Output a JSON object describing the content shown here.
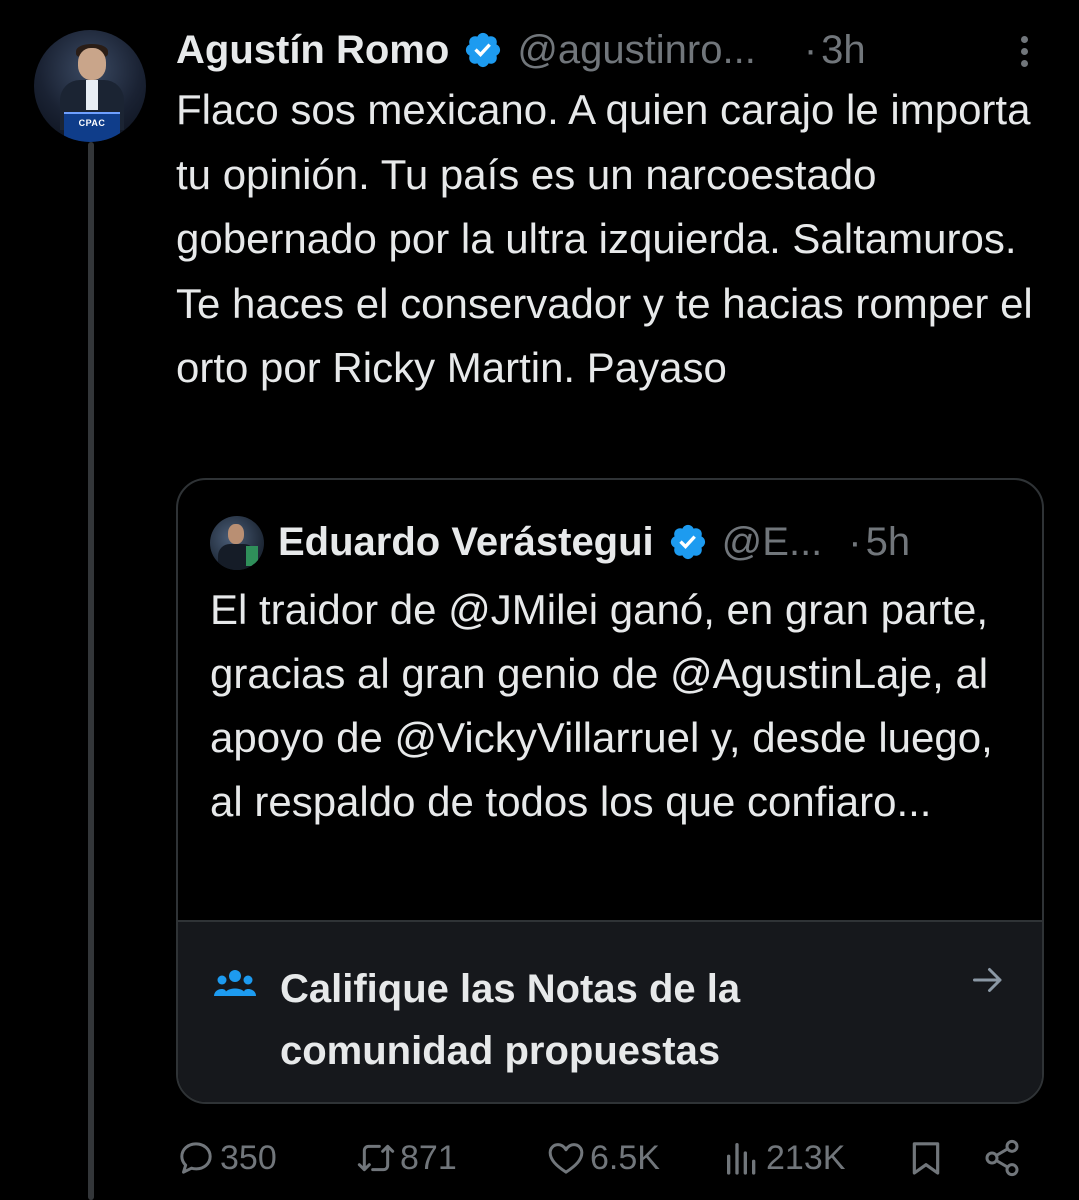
{
  "tweet": {
    "author_name": "Agustín Romo",
    "author_handle": "@agustinro...",
    "separator": "·",
    "time": "3h",
    "text": "Flaco sos mexicano. A quien carajo le importa tu opinión. Tu país es un narcoestado gobernado por la ultra izquierda. Saltamuros. Te haces el conservador y te hacias romper el orto por Ricky Martin. Payaso",
    "avatar_label": "CPAC"
  },
  "quote": {
    "author_name": "Eduardo Verástegui",
    "author_handle": "@E...",
    "separator": "·",
    "time": "5h",
    "text": "El traidor de @JMilei ganó, en gran parte, gracias al gran genio de @AgustinLaje, al apoyo de @VickyVillarruel y, desde luego, al respaldo de todos los que confiaro..."
  },
  "community_notes": {
    "label": "Califique las Notas de la comunidad propuestas"
  },
  "actions": {
    "replies": "350",
    "retweets": "871",
    "likes": "6.5K",
    "views": "213K"
  },
  "colors": {
    "background": "#000000",
    "text": "#e7e9ea",
    "muted": "#71767b",
    "verified": "#1d9bf0",
    "border": "#2f3336",
    "notes_bg": "#16181c"
  },
  "icons": {
    "verified": "verified-badge-icon",
    "more": "more-options-icon",
    "notes": "people-icon",
    "arrow": "arrow-right-icon",
    "reply": "reply-icon",
    "retweet": "retweet-icon",
    "like": "heart-icon",
    "views": "views-chart-icon",
    "bookmark": "bookmark-icon",
    "share": "share-icon"
  }
}
